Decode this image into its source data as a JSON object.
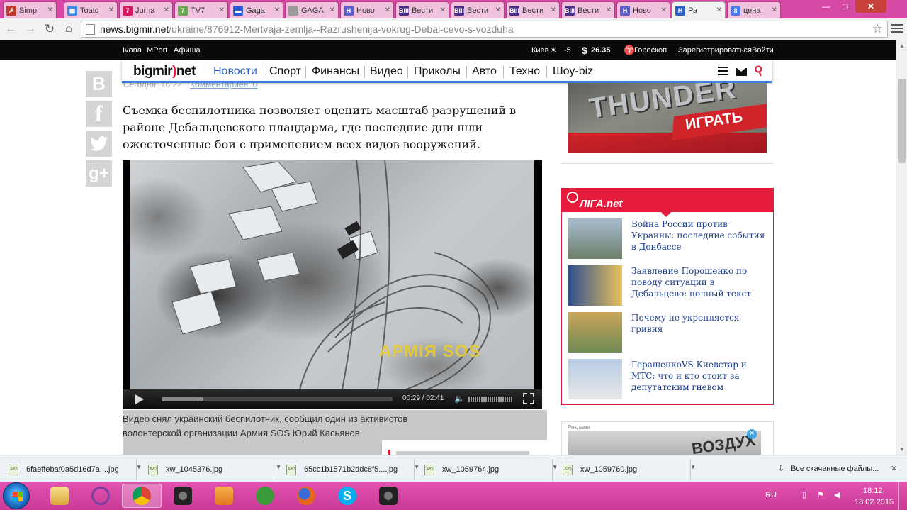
{
  "browser": {
    "tabs": [
      {
        "title": "Simp",
        "favicon_color": "#c0392b"
      },
      {
        "title": "Toatc",
        "favicon_color": "#3d8be0"
      },
      {
        "title": "Jurna",
        "favicon_color": "#d81b60"
      },
      {
        "title": "TV7",
        "favicon_color": "#6aa84f"
      },
      {
        "title": "Gaga",
        "favicon_color": "#2a5bd7"
      },
      {
        "title": "GAGA",
        "favicon_color": "#999999"
      },
      {
        "title": "Ново",
        "favicon_color": "#5a5ec8"
      },
      {
        "title": "Вести",
        "favicon_color": "#4a2f8a"
      },
      {
        "title": "Вести",
        "favicon_color": "#4a2f8a"
      },
      {
        "title": "Вести",
        "favicon_color": "#4a2f8a"
      },
      {
        "title": "Вести",
        "favicon_color": "#4a2f8a"
      },
      {
        "title": "Ново",
        "favicon_color": "#5a5ec8"
      },
      {
        "title": "Ра",
        "favicon_color": "#2d63c8"
      },
      {
        "title": "цена",
        "favicon_color": "#4a7bea"
      }
    ],
    "tab_favicon_letters": [
      "☭",
      "▦",
      "7",
      "7",
      "▬",
      "",
      "Н",
      "BIII",
      "BIII",
      "BIII",
      "BIII",
      "Н",
      "Н",
      "8"
    ],
    "url_domain": "news.bigmir.net",
    "url_path": "/ukraine/876912-Mertvaja-zemlja--Razrushenija-vokrug-Debal-cevo-s-vozduha",
    "window_controls": {
      "minimize": "—",
      "maximize": "□",
      "close": "✕"
    }
  },
  "site": {
    "topbar": {
      "links": [
        "Ivona",
        "MPort",
        "Афиша"
      ],
      "city": "Киев",
      "temperature": "-5",
      "currency": "26.35",
      "horoscope": "Гороскоп",
      "register": "Зарегистрироваться",
      "login": "Войти"
    },
    "logo": {
      "main": "bigmir",
      "paren": ")",
      "suffix": "net"
    },
    "nav": [
      "Новости",
      "Спорт",
      "Финансы",
      "Видео",
      "Приколы",
      "Авто",
      "Техно",
      "Шоу-biz"
    ]
  },
  "article": {
    "date": "Сегодня, 16:22",
    "comments": "Комментариев: 0",
    "lead": "Съемка беспилотника позволяет оценить масштаб разрушений в районе Дебальцевского плацдарма, где последние дни шли ожесточенные бои с применением всех видов вооружений.",
    "video": {
      "watermark": "АРМІЯ SOS",
      "time": "00:29 / 02:41",
      "progress": 0.18
    },
    "caption_line1": "Видео снял украинский беспилотник, сообщил один из активистов",
    "caption_line2": "волонтерской организации Армия SOS Юрий Касьянов."
  },
  "social": [
    "В",
    "f",
    "twitter-bird",
    "g+"
  ],
  "ads": {
    "top": {
      "brand": "THUNDER",
      "button": "ИГРАТЬ"
    },
    "bottom": {
      "label": "Реклама",
      "text": "ВОЗДУХ",
      "close": "✕"
    }
  },
  "liga": {
    "logo": "ЛІГА.net",
    "items": [
      {
        "text": "Война России против Украины: последние события в Донбассе",
        "thumb": "#8fa2b8"
      },
      {
        "text": "Заявление Порошенко по поводу ситуации в Дебальцево: полный текст",
        "thumb": "#2f4f8f"
      },
      {
        "text": "Почему не укрепляется гривня",
        "thumb": "#b99a4f"
      },
      {
        "text": "ГеращенкоVS Киевстар и МТС: что и кто стоит за депутатским гневом",
        "thumb": "#9fb6d6"
      }
    ]
  },
  "downloads": {
    "items": [
      "6faeffebaf0a5d16d7a....jpg",
      "xw_1045376.jpg",
      "65cc1b1571b2ddc8f5....jpg",
      "xw_1059764.jpg",
      "xw_1059760.jpg"
    ],
    "show_all": "Все скачанные файлы...",
    "close": "✕"
  },
  "taskbar": {
    "apps": [
      {
        "name": "explorer",
        "color": "#e7c35a"
      },
      {
        "name": "sticky",
        "color": "#7d3fa0"
      },
      {
        "name": "chrome",
        "color": "#4285f4"
      },
      {
        "name": "camera",
        "color": "#333333"
      },
      {
        "name": "media-player",
        "color": "#f08c2e"
      },
      {
        "name": "utorrent",
        "color": "#3b9b3b"
      },
      {
        "name": "firefox",
        "color": "#e8661c"
      },
      {
        "name": "skype",
        "color": "#00aff0"
      },
      {
        "name": "camera2",
        "color": "#333333"
      }
    ],
    "lang": "RU",
    "time": "18:12",
    "date": "18.02.2015"
  }
}
